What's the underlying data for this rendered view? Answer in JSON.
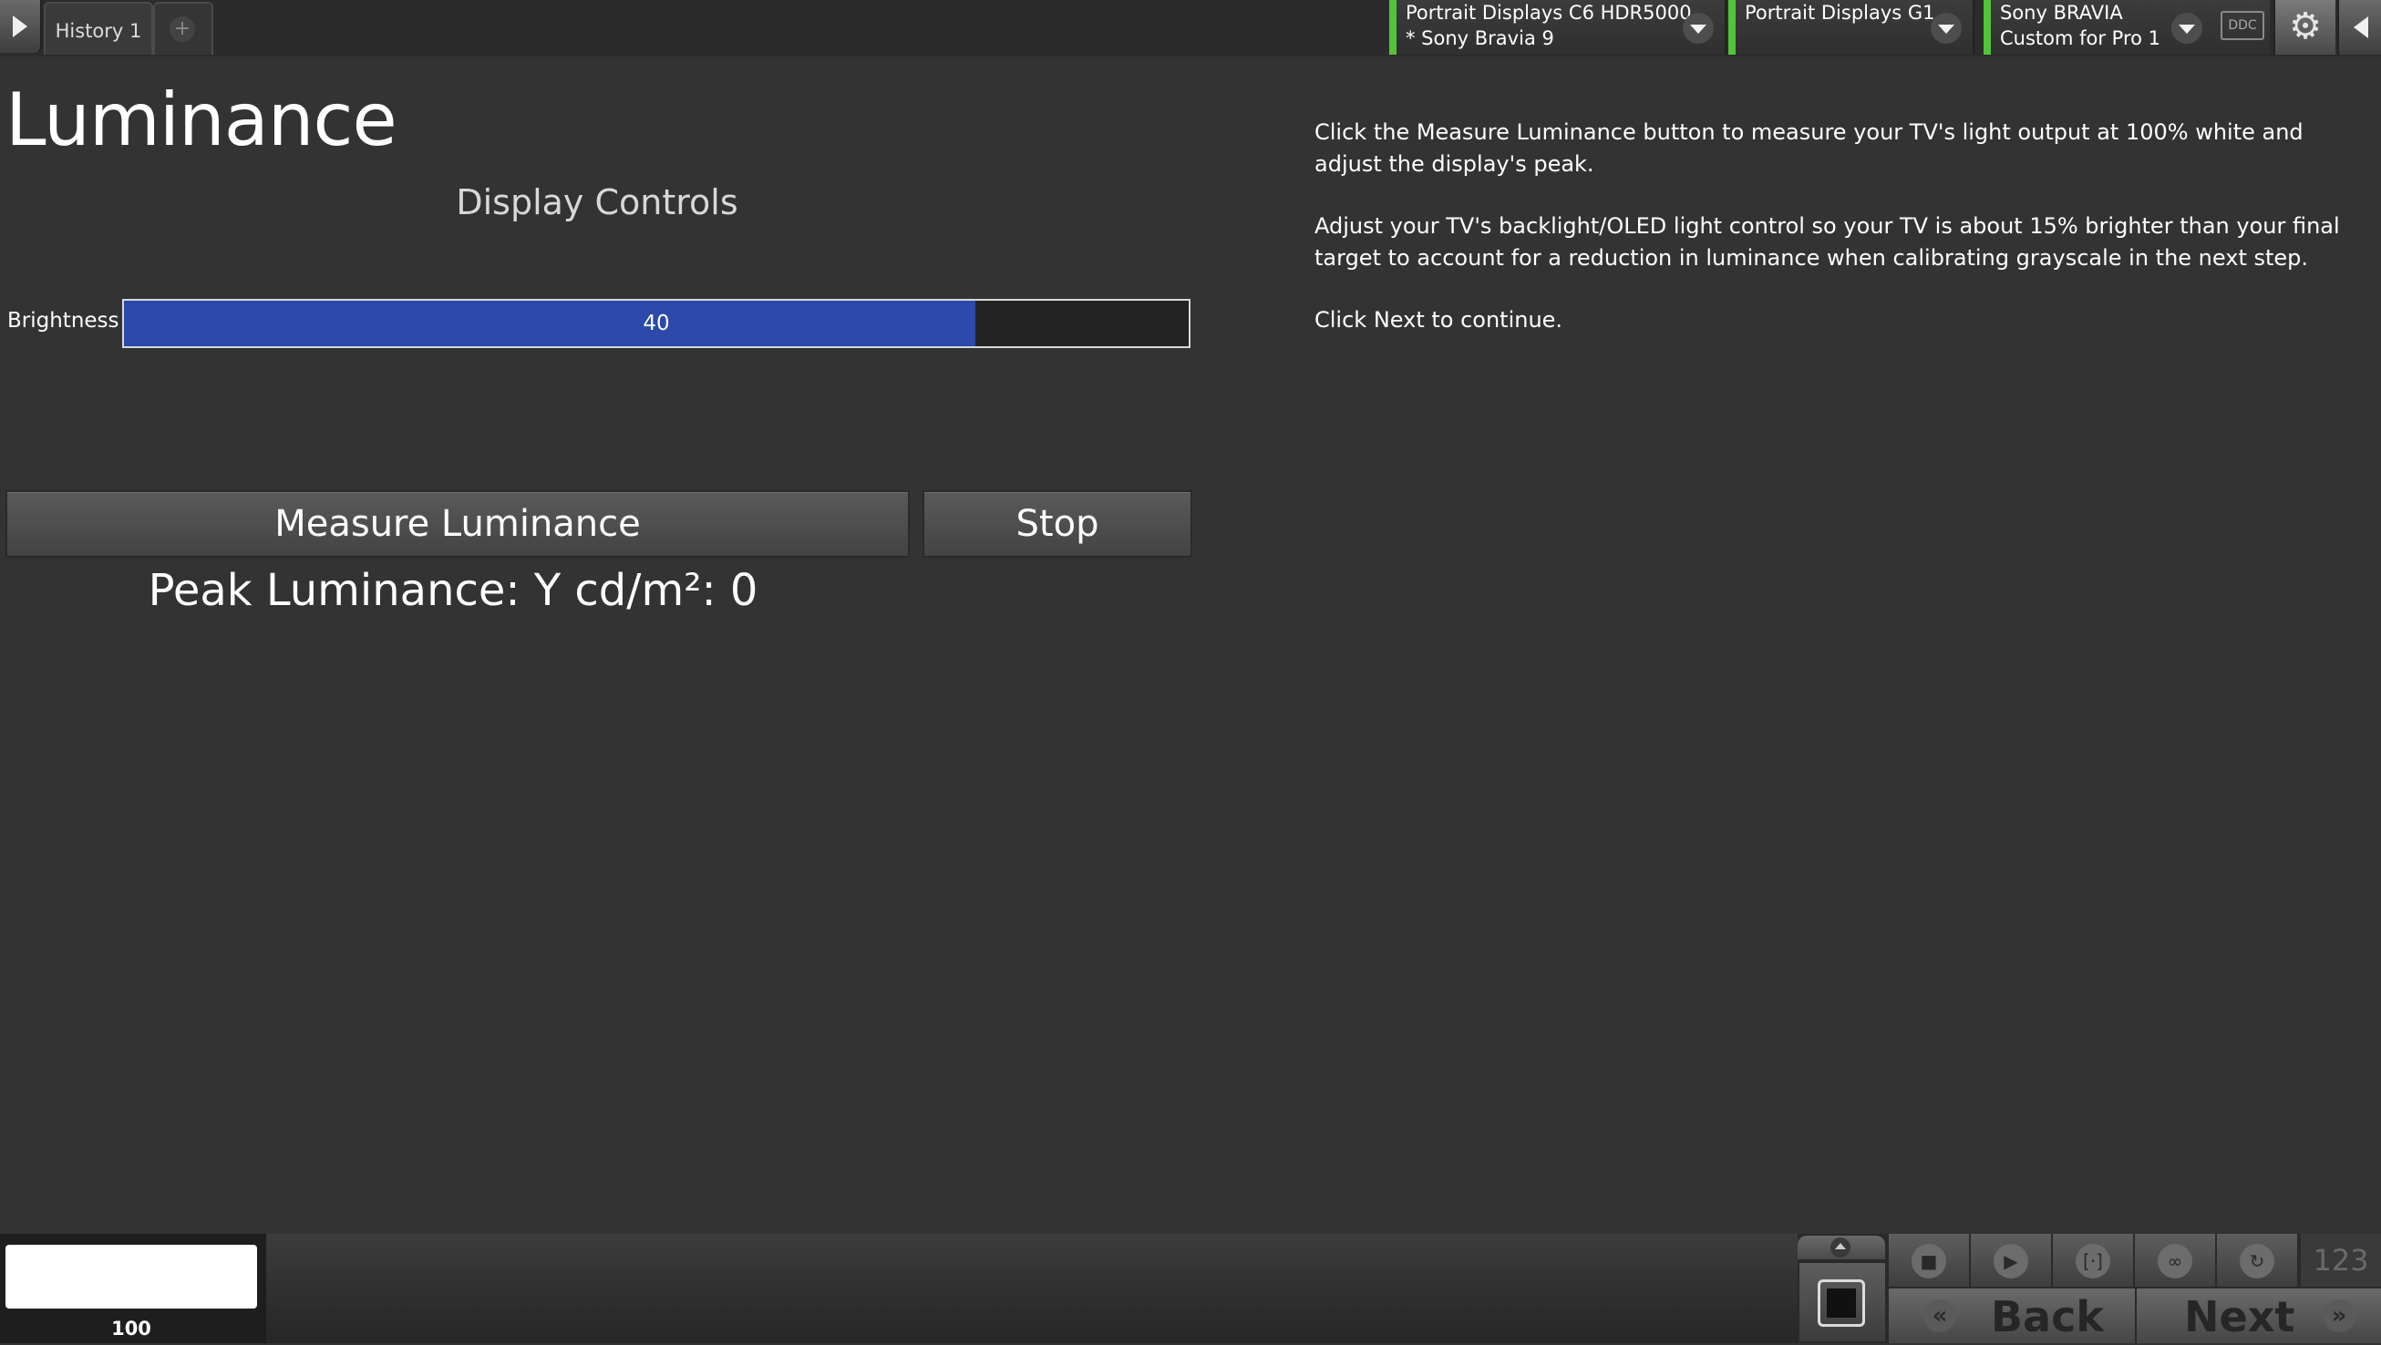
{
  "topbar": {
    "history_tab": "History 1",
    "add_tab": "+",
    "devices": [
      {
        "line1": "Portrait Displays C6 HDR5000",
        "line2": "* Sony Bravia 9"
      },
      {
        "line1": "Portrait Displays G1",
        "line2": ""
      },
      {
        "line1": "Sony BRAVIA",
        "line2": "Custom for Pro 1"
      }
    ],
    "ddc_label": "DDC",
    "accent_color": "#53c43a"
  },
  "main": {
    "title": "Luminance",
    "display_controls": "Display Controls",
    "brightness": {
      "label": "Brightness",
      "value": "40",
      "fill_fraction": 0.8
    },
    "measure_button": "Measure Luminance",
    "stop_button": "Stop",
    "peak_text": "Peak Luminance: Y cd/m²: 0"
  },
  "instructions": [
    "Click the Measure Luminance button to measure your TV's light output at 100% white and adjust the display's peak.",
    "Adjust your TV's backlight/OLED light control so your TV is about 15% brighter than your final target to account for a reduction in luminance when calibrating grayscale in the next step.",
    "Click Next to continue."
  ],
  "bottom": {
    "swatch_label": "100",
    "counter": "123",
    "back_label": "Back",
    "next_label": "Next"
  }
}
